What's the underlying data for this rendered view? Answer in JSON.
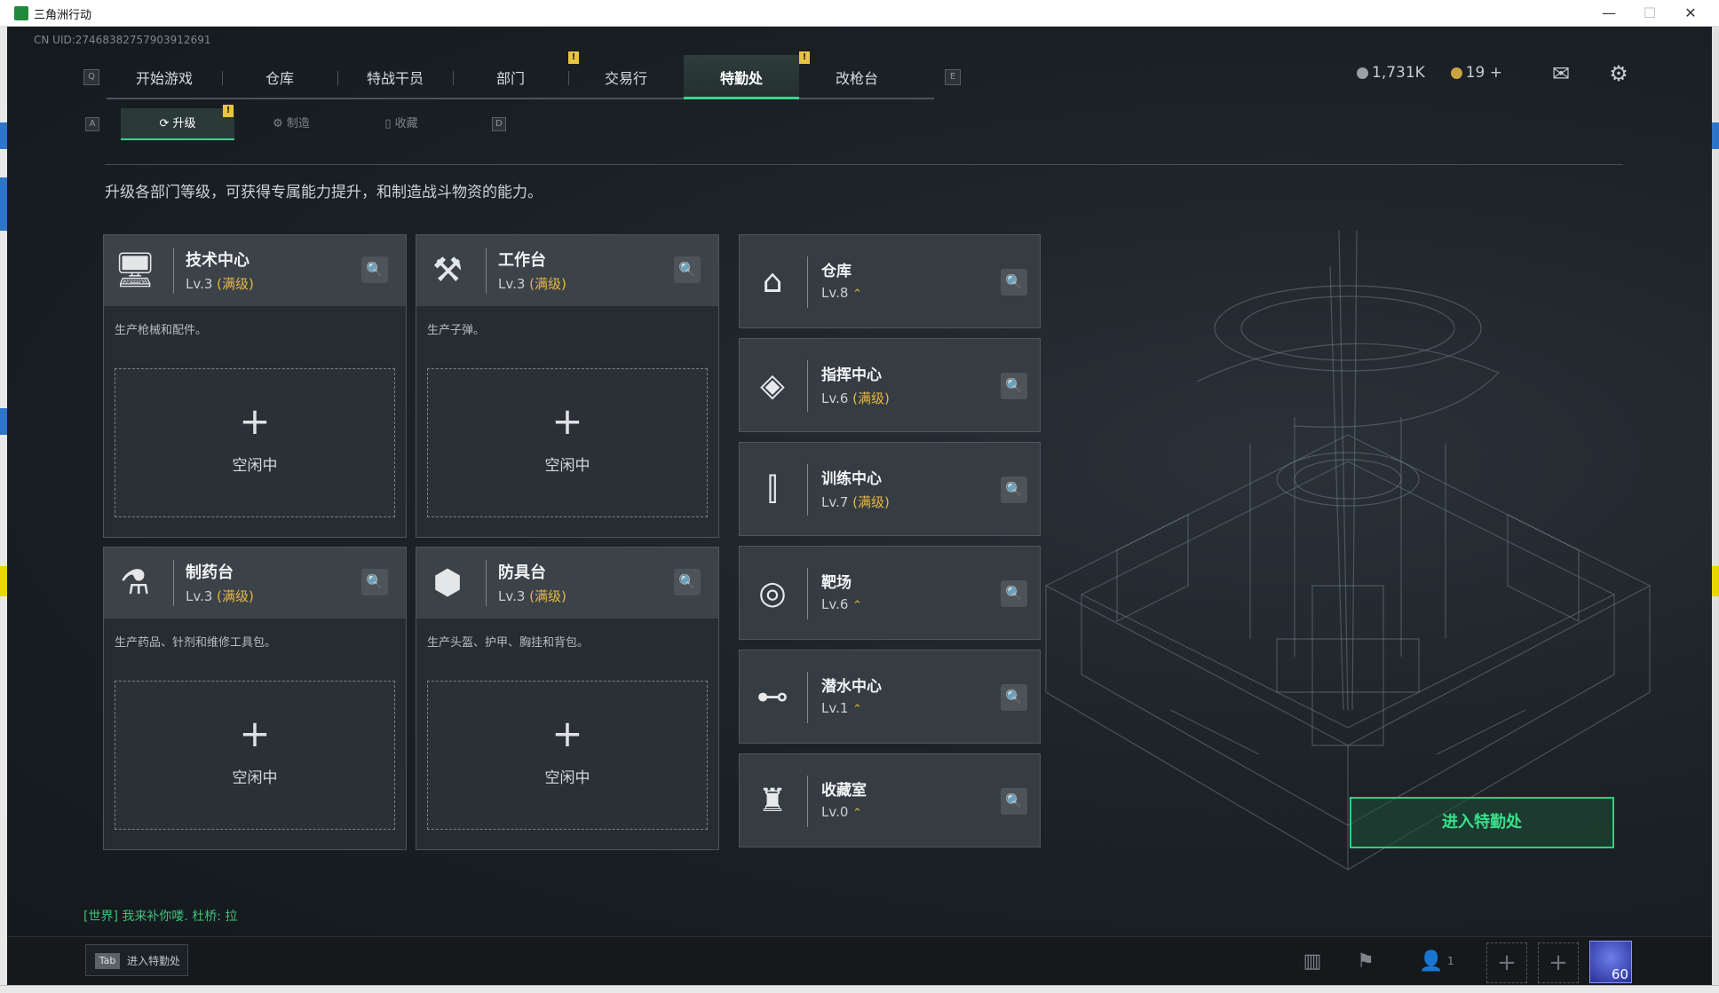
{
  "window": {
    "title": "三角洲行动",
    "minimize": "—",
    "maximize": "☐",
    "close": "✕"
  },
  "uid": "CN UID:2746838275790391269​1",
  "nav": {
    "left_key": "Q",
    "right_key": "E",
    "tabs": [
      "开始游戏",
      "仓库",
      "特战干员",
      "部门",
      "交易行",
      "特勤处",
      "改枪台"
    ],
    "active": "特勤处",
    "badges": [
      "!",
      "!"
    ]
  },
  "currency": {
    "silver": "1,731K",
    "gold": "19",
    "gold_add": "+"
  },
  "subnav": {
    "left_key": "A",
    "right_key": "D",
    "tabs": [
      {
        "label": "升级",
        "icon": "upgrade-icon"
      },
      {
        "label": "制造",
        "icon": "craft-icon"
      },
      {
        "label": "收藏",
        "icon": "collection-icon"
      }
    ],
    "badge": "!"
  },
  "description": "升级各部门等级，可获得专属能力提升，和制造战斗物资的能力。",
  "workbenches": [
    {
      "name": "技术中心",
      "level": "Lv.3",
      "maxed": "(满级)",
      "desc": "生产枪械和配件。",
      "slot": "空闲中",
      "icon": "computer-icon",
      "glyph": "🖥"
    },
    {
      "name": "工作台",
      "level": "Lv.3",
      "maxed": "(满级)",
      "desc": "生产子弹。",
      "slot": "空闲中",
      "icon": "tools-icon",
      "glyph": "⚒"
    },
    {
      "name": "制药台",
      "level": "Lv.3",
      "maxed": "(满级)",
      "desc": "生产药品、针剂和维修工具包。",
      "slot": "空闲中",
      "icon": "microscope-icon",
      "glyph": "⚗"
    },
    {
      "name": "防具台",
      "level": "Lv.3",
      "maxed": "(满级)",
      "desc": "生产头盔、护甲、胸挂和背包。",
      "slot": "空闲中",
      "icon": "armor-icon",
      "glyph": "⬢"
    }
  ],
  "facilities": [
    {
      "name": "仓库",
      "level": "Lv.8",
      "status": "",
      "upgradable": true,
      "icon": "storage-icon",
      "glyph": "⌂"
    },
    {
      "name": "指挥中心",
      "level": "Lv.6",
      "status": "(满级)",
      "upgradable": false,
      "icon": "command-icon",
      "glyph": "◈"
    },
    {
      "name": "训练中心",
      "level": "Lv.7",
      "status": "(满级)",
      "upgradable": false,
      "icon": "dumbbell-icon",
      "glyph": "⫿"
    },
    {
      "name": "靶场",
      "level": "Lv.6",
      "status": "",
      "upgradable": true,
      "icon": "target-icon",
      "glyph": "◎"
    },
    {
      "name": "潜水中心",
      "level": "Lv.1",
      "status": "",
      "upgradable": true,
      "icon": "diving-mask-icon",
      "glyph": "⊷"
    },
    {
      "name": "收藏室",
      "level": "Lv.0",
      "status": "",
      "upgradable": true,
      "icon": "trophy-icon",
      "glyph": "♜"
    }
  ],
  "upgrade_arrow": "⌃",
  "enter_button": "进入特勤处",
  "chat": {
    "channel": "[世界]",
    "message": "我来补你喽. 杜桥: 拉"
  },
  "bottom": {
    "tab_key": "Tab",
    "tab_label": "进入特勤处",
    "party_count": "1",
    "avatar_level": "60"
  },
  "colors": {
    "accent": "#3cd28a",
    "maxed": "#e7b742",
    "badge": "#e9c440"
  }
}
